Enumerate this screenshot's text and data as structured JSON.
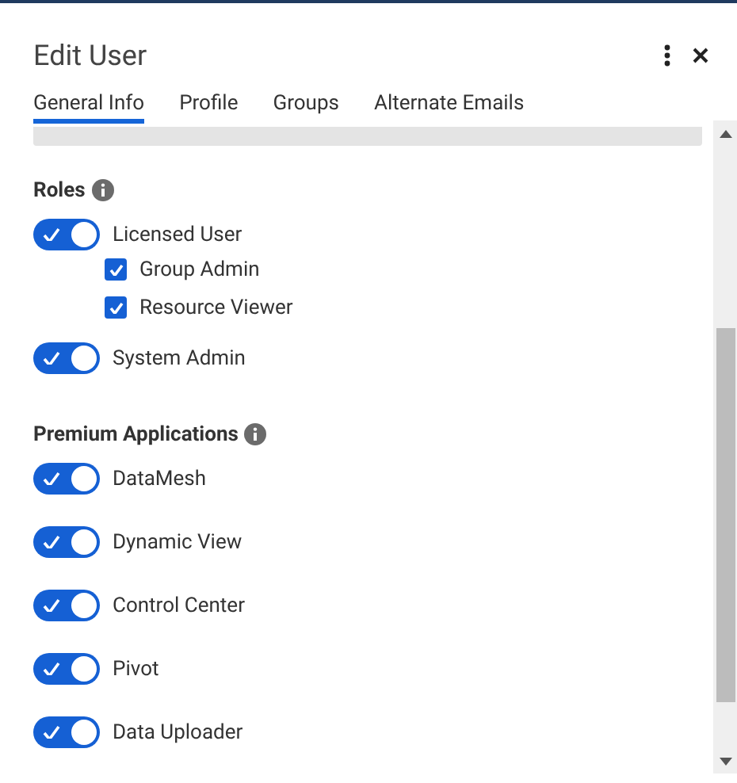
{
  "dialog": {
    "title": "Edit User"
  },
  "tabs": [
    {
      "label": "General Info",
      "selected": true
    },
    {
      "label": "Profile",
      "selected": false
    },
    {
      "label": "Groups",
      "selected": false
    },
    {
      "label": "Alternate Emails",
      "selected": false
    }
  ],
  "sections": [
    {
      "title": "Roles",
      "items": [
        {
          "label": "Licensed User",
          "on": true,
          "children": [
            {
              "label": "Group Admin",
              "checked": true
            },
            {
              "label": "Resource Viewer",
              "checked": true
            }
          ]
        },
        {
          "label": "System Admin",
          "on": true
        }
      ]
    },
    {
      "title": "Premium Applications",
      "items": [
        {
          "label": "DataMesh",
          "on": true
        },
        {
          "label": "Dynamic View",
          "on": true
        },
        {
          "label": "Control Center",
          "on": true
        },
        {
          "label": "Pivot",
          "on": true
        },
        {
          "label": "Data Uploader",
          "on": true
        }
      ]
    }
  ]
}
